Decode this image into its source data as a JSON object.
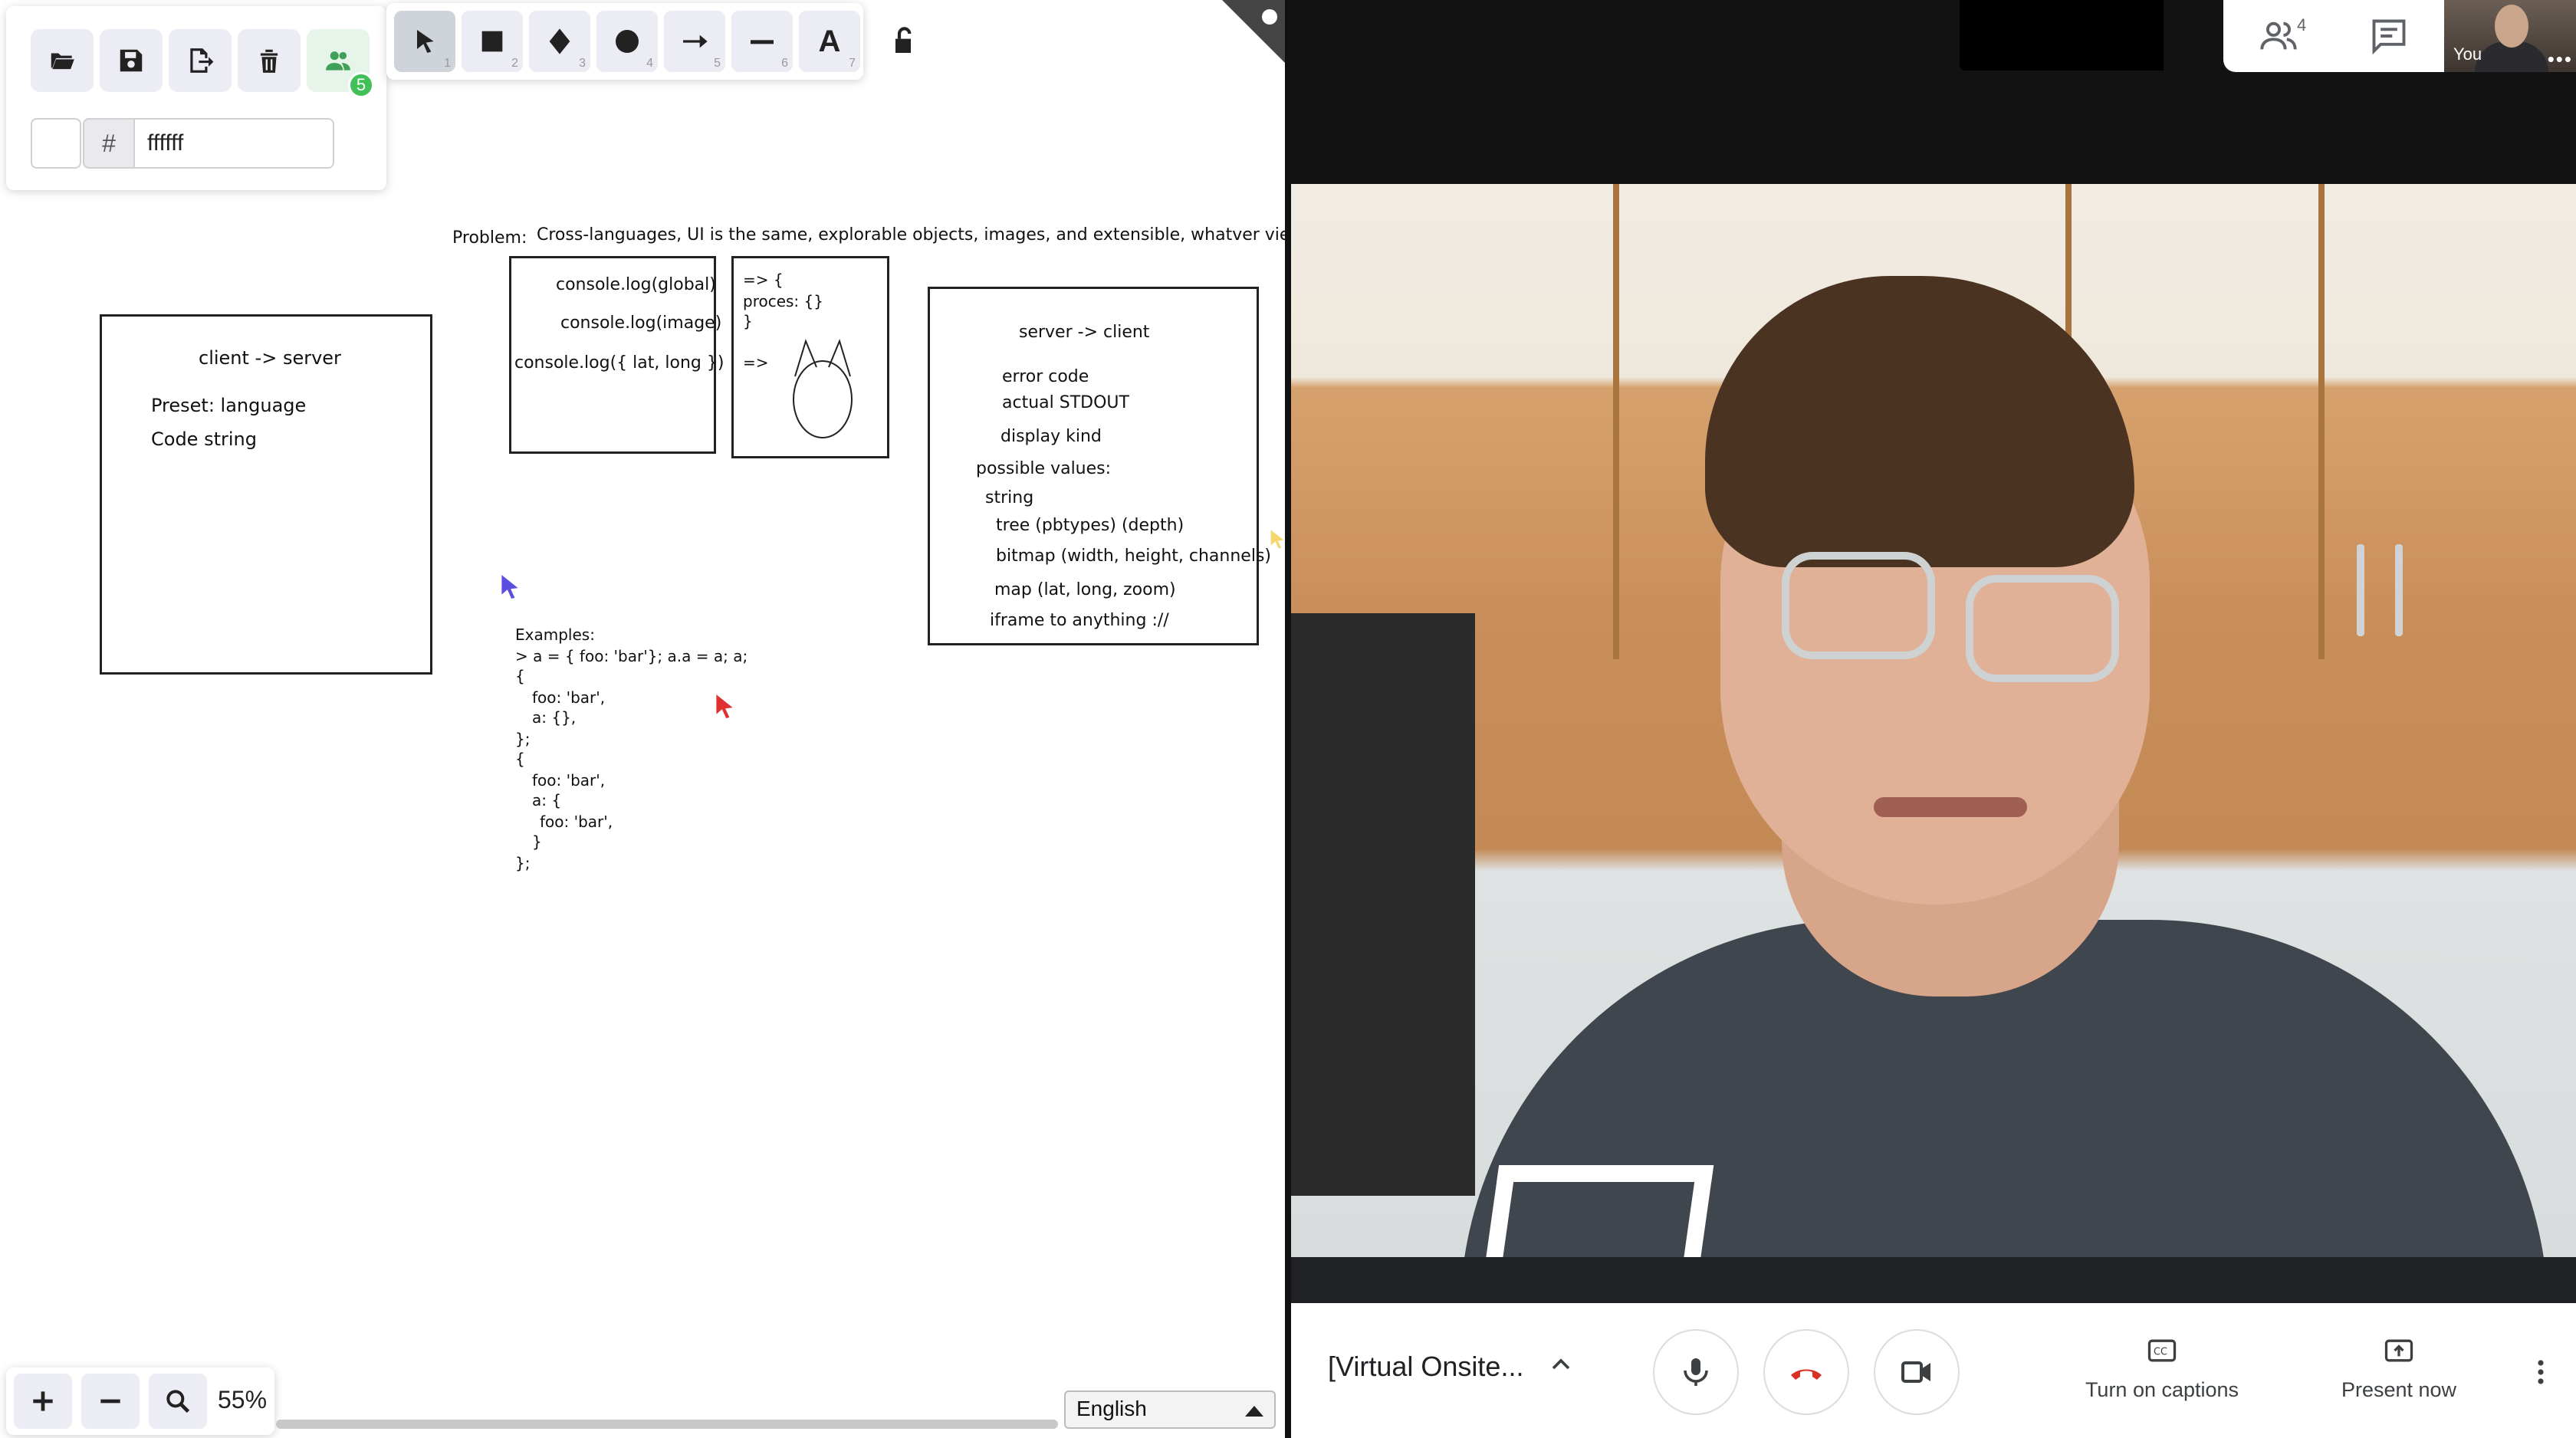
{
  "whiteboard": {
    "file_tools": {
      "open_label": "open",
      "save_label": "save",
      "export_label": "export",
      "clear_label": "clear",
      "collab_count": "5"
    },
    "color": {
      "hash": "#",
      "hex_value": "ffffff"
    },
    "tools": [
      {
        "name": "selection",
        "key": "1"
      },
      {
        "name": "rectangle",
        "key": "2"
      },
      {
        "name": "diamond",
        "key": "3"
      },
      {
        "name": "ellipse",
        "key": "4"
      },
      {
        "name": "arrow",
        "key": "5"
      },
      {
        "name": "line",
        "key": "6"
      },
      {
        "name": "text",
        "key": "7",
        "glyph": "A"
      }
    ],
    "canvas": {
      "problem_label": "Problem:",
      "problem_text": "Cross-languages, UI is the same, explorable objects, images, and extensible, whatver vie",
      "client_box": {
        "title": "client -> server",
        "lines": [
          "Preset: language",
          "Code string"
        ]
      },
      "console_box": {
        "lines": [
          "console.log(global)",
          "console.log(image)",
          "console.log({ lat, long })"
        ]
      },
      "output_box": {
        "lines": [
          "=> {",
          "proces: {}",
          "}",
          "=>"
        ]
      },
      "server_box": {
        "title": "server -> client",
        "lines": [
          "error code",
          "actual STDOUT",
          "display kind",
          "possible values:",
          "string",
          "tree (pbtypes) (depth)",
          "bitmap (width, height, channels)",
          "map (lat, long, zoom)",
          "iframe to anything ://"
        ]
      },
      "examples": {
        "lines": [
          "Examples:",
          "> a = { foo: 'bar'}; a.a = a; a;",
          "{",
          "  foo: 'bar',",
          "  a: {},",
          "};",
          "{",
          "  foo: 'bar',",
          "  a: {",
          "    foo: 'bar',",
          "  }",
          "};"
        ]
      }
    },
    "zoom": {
      "level": "55%"
    },
    "language": {
      "selected": "English"
    }
  },
  "meet": {
    "top": {
      "people_count": "4",
      "self_label": "You",
      "self_more": "•••"
    },
    "bottom": {
      "meeting_title": "[Virtual Onsite...",
      "captions_label": "Turn on captions",
      "present_label": "Present now"
    },
    "colors": {
      "hangup_red": "#d93025",
      "accent_green": "#40c057"
    }
  }
}
